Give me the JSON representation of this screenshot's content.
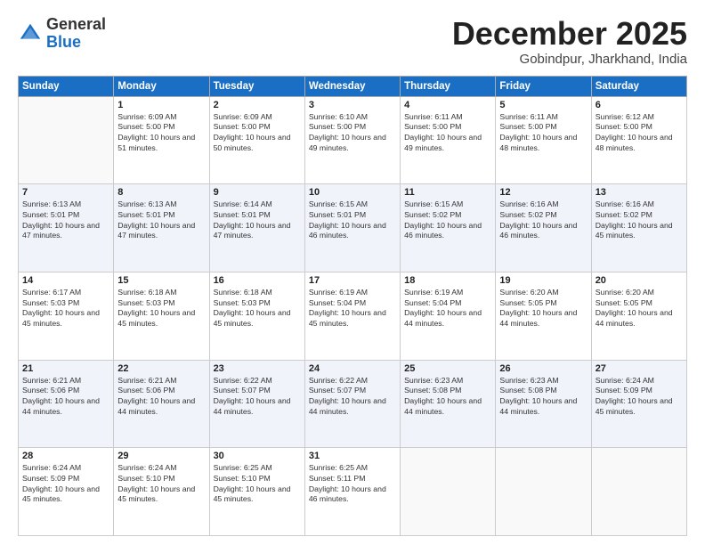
{
  "header": {
    "logo": {
      "line1": "General",
      "line2": "Blue"
    },
    "title": "December 2025",
    "subtitle": "Gobindpur, Jharkhand, India"
  },
  "weekdays": [
    "Sunday",
    "Monday",
    "Tuesday",
    "Wednesday",
    "Thursday",
    "Friday",
    "Saturday"
  ],
  "weeks": [
    [
      {
        "day": null
      },
      {
        "day": "1",
        "sunrise": "6:09 AM",
        "sunset": "5:00 PM",
        "daylight": "10 hours and 51 minutes."
      },
      {
        "day": "2",
        "sunrise": "6:09 AM",
        "sunset": "5:00 PM",
        "daylight": "10 hours and 50 minutes."
      },
      {
        "day": "3",
        "sunrise": "6:10 AM",
        "sunset": "5:00 PM",
        "daylight": "10 hours and 49 minutes."
      },
      {
        "day": "4",
        "sunrise": "6:11 AM",
        "sunset": "5:00 PM",
        "daylight": "10 hours and 49 minutes."
      },
      {
        "day": "5",
        "sunrise": "6:11 AM",
        "sunset": "5:00 PM",
        "daylight": "10 hours and 48 minutes."
      },
      {
        "day": "6",
        "sunrise": "6:12 AM",
        "sunset": "5:00 PM",
        "daylight": "10 hours and 48 minutes."
      }
    ],
    [
      {
        "day": "7",
        "sunrise": "6:13 AM",
        "sunset": "5:01 PM",
        "daylight": "10 hours and 47 minutes."
      },
      {
        "day": "8",
        "sunrise": "6:13 AM",
        "sunset": "5:01 PM",
        "daylight": "10 hours and 47 minutes."
      },
      {
        "day": "9",
        "sunrise": "6:14 AM",
        "sunset": "5:01 PM",
        "daylight": "10 hours and 47 minutes."
      },
      {
        "day": "10",
        "sunrise": "6:15 AM",
        "sunset": "5:01 PM",
        "daylight": "10 hours and 46 minutes."
      },
      {
        "day": "11",
        "sunrise": "6:15 AM",
        "sunset": "5:02 PM",
        "daylight": "10 hours and 46 minutes."
      },
      {
        "day": "12",
        "sunrise": "6:16 AM",
        "sunset": "5:02 PM",
        "daylight": "10 hours and 46 minutes."
      },
      {
        "day": "13",
        "sunrise": "6:16 AM",
        "sunset": "5:02 PM",
        "daylight": "10 hours and 45 minutes."
      }
    ],
    [
      {
        "day": "14",
        "sunrise": "6:17 AM",
        "sunset": "5:03 PM",
        "daylight": "10 hours and 45 minutes."
      },
      {
        "day": "15",
        "sunrise": "6:18 AM",
        "sunset": "5:03 PM",
        "daylight": "10 hours and 45 minutes."
      },
      {
        "day": "16",
        "sunrise": "6:18 AM",
        "sunset": "5:03 PM",
        "daylight": "10 hours and 45 minutes."
      },
      {
        "day": "17",
        "sunrise": "6:19 AM",
        "sunset": "5:04 PM",
        "daylight": "10 hours and 45 minutes."
      },
      {
        "day": "18",
        "sunrise": "6:19 AM",
        "sunset": "5:04 PM",
        "daylight": "10 hours and 44 minutes."
      },
      {
        "day": "19",
        "sunrise": "6:20 AM",
        "sunset": "5:05 PM",
        "daylight": "10 hours and 44 minutes."
      },
      {
        "day": "20",
        "sunrise": "6:20 AM",
        "sunset": "5:05 PM",
        "daylight": "10 hours and 44 minutes."
      }
    ],
    [
      {
        "day": "21",
        "sunrise": "6:21 AM",
        "sunset": "5:06 PM",
        "daylight": "10 hours and 44 minutes."
      },
      {
        "day": "22",
        "sunrise": "6:21 AM",
        "sunset": "5:06 PM",
        "daylight": "10 hours and 44 minutes."
      },
      {
        "day": "23",
        "sunrise": "6:22 AM",
        "sunset": "5:07 PM",
        "daylight": "10 hours and 44 minutes."
      },
      {
        "day": "24",
        "sunrise": "6:22 AM",
        "sunset": "5:07 PM",
        "daylight": "10 hours and 44 minutes."
      },
      {
        "day": "25",
        "sunrise": "6:23 AM",
        "sunset": "5:08 PM",
        "daylight": "10 hours and 44 minutes."
      },
      {
        "day": "26",
        "sunrise": "6:23 AM",
        "sunset": "5:08 PM",
        "daylight": "10 hours and 44 minutes."
      },
      {
        "day": "27",
        "sunrise": "6:24 AM",
        "sunset": "5:09 PM",
        "daylight": "10 hours and 45 minutes."
      }
    ],
    [
      {
        "day": "28",
        "sunrise": "6:24 AM",
        "sunset": "5:09 PM",
        "daylight": "10 hours and 45 minutes."
      },
      {
        "day": "29",
        "sunrise": "6:24 AM",
        "sunset": "5:10 PM",
        "daylight": "10 hours and 45 minutes."
      },
      {
        "day": "30",
        "sunrise": "6:25 AM",
        "sunset": "5:10 PM",
        "daylight": "10 hours and 45 minutes."
      },
      {
        "day": "31",
        "sunrise": "6:25 AM",
        "sunset": "5:11 PM",
        "daylight": "10 hours and 46 minutes."
      },
      {
        "day": null
      },
      {
        "day": null
      },
      {
        "day": null
      }
    ]
  ]
}
